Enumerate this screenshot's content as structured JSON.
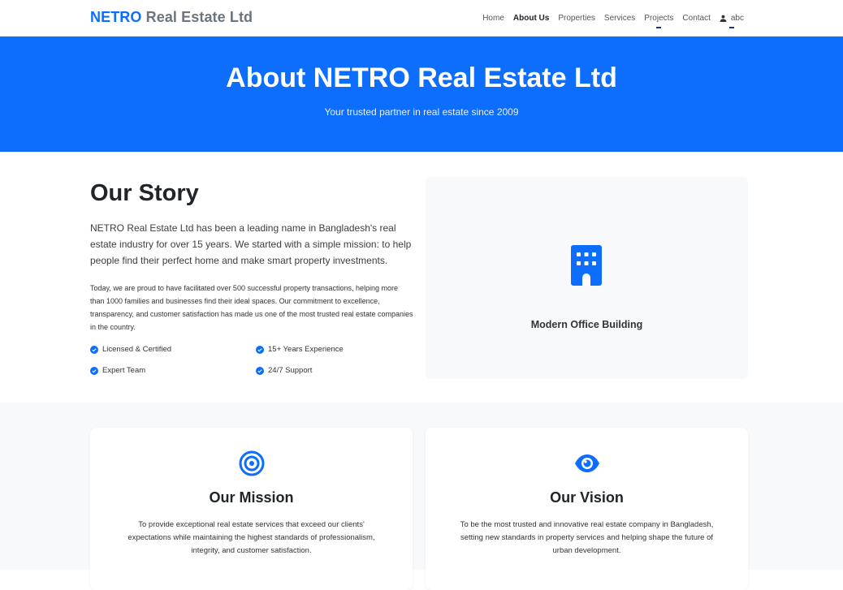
{
  "navbar": {
    "brand_part1": "NETRO",
    "brand_part2": "Real Estate Ltd",
    "items": [
      "Home",
      "About Us",
      "Properties",
      "Services",
      "Projects",
      "Contact"
    ],
    "active": "About Us",
    "user_name": "abc",
    "user_icon": "user-icon"
  },
  "hero": {
    "title": "About NETRO Real Estate Ltd",
    "subtitle": "Your trusted partner in real estate since 2009",
    "background_color": "#0d6efd"
  },
  "story": {
    "heading": "Our Story",
    "lead": "NETRO Real Estate Ltd has been a leading name in Bangladesh's real estate industry for over 15 years. We started with a simple mission: to help people find their perfect home and make smart property investments.",
    "body": "Today, we are proud to have facilitated over 500 successful property transactions, helping more than 1000 families and businesses find their ideal spaces. Our commitment to excellence, transparency, and customer satisfaction has made us one of the most trusted real estate companies in the country.",
    "features": [
      "Licensed & Certified",
      "15+ Years Experience",
      "Expert Team",
      "24/7 Support"
    ],
    "feature_icon": "check-circle-icon",
    "image_placeholder": {
      "icon": "building-icon",
      "label": "Modern Office Building"
    }
  },
  "mission": {
    "icon": "target-icon",
    "title": "Our Mission",
    "text": "To provide exceptional real estate services that exceed our clients' expectations while maintaining the highest standards of professionalism, integrity, and customer satisfaction."
  },
  "vision": {
    "icon": "eye-icon",
    "title": "Our Vision",
    "text": "To be the most trusted and innovative real estate company in Bangladesh, setting new standards in property services and helping shape the future of urban development."
  },
  "colors": {
    "primary": "#0d6efd",
    "muted": "#6c757d",
    "light_bg": "#f8f9fa"
  }
}
